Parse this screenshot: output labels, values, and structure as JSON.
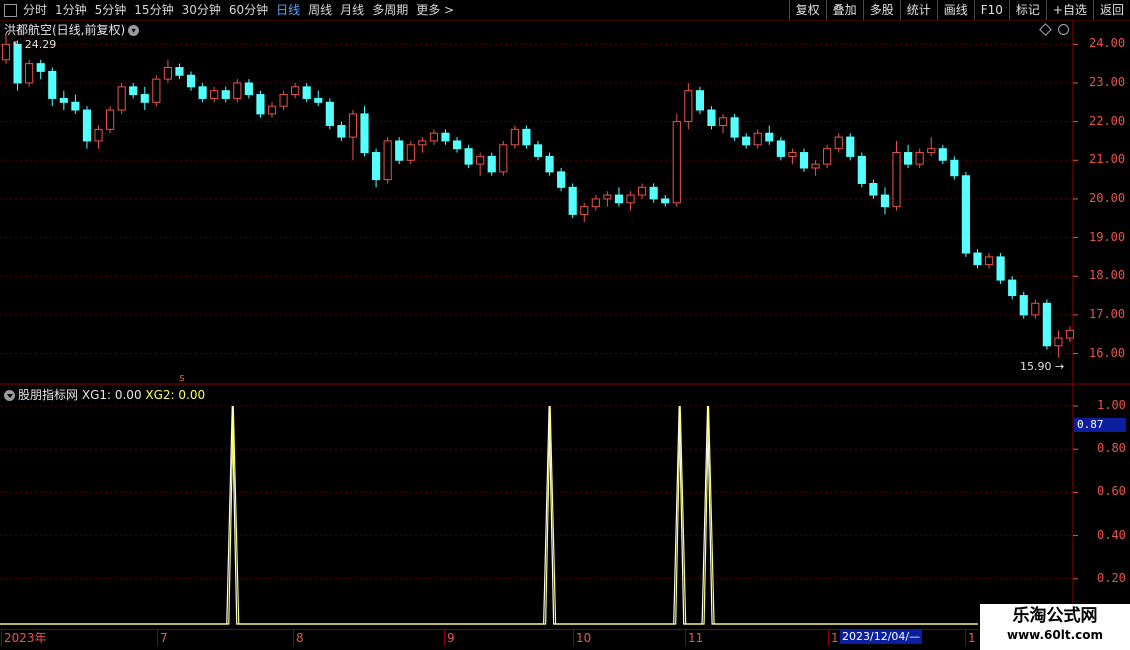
{
  "toolbar": {
    "periods": [
      "分时",
      "1分钟",
      "5分钟",
      "15分钟",
      "30分钟",
      "60分钟",
      "日线",
      "周线",
      "月线",
      "多周期",
      "更多"
    ],
    "active_period": "日线",
    "buttons": [
      "复权",
      "叠加",
      "多股",
      "统计",
      "画线",
      "F10",
      "标记",
      "+自选",
      "返回"
    ]
  },
  "main_chart": {
    "title": "洪都航空(日线,前复权)",
    "max_label": "24.29",
    "min_label": "15.90",
    "y_ticks": [
      "24.00",
      "23.00",
      "22.00",
      "21.00",
      "20.00",
      "19.00",
      "18.00",
      "17.00",
      "16.00"
    ],
    "signal_marker": "s"
  },
  "sub_chart": {
    "indicator_name": "股朋指标网",
    "xg1_label": "XG1: 0.00",
    "xg2_label": "XG2: 0.00",
    "y_ticks": [
      "1.00",
      "0.80",
      "0.60",
      "0.40",
      "0.20"
    ],
    "cursor_value": "0.87"
  },
  "date_axis": {
    "labels": [
      "2023年",
      "7",
      "8",
      "9",
      "10",
      "11",
      "1",
      "1"
    ],
    "current_date": "2023/12/04/—"
  },
  "watermark": {
    "title": "乐淘公式网",
    "url": "www.60lt.com"
  },
  "colors": {
    "up": "#e8544a",
    "down": "#54ffff",
    "xg1": "#ffffff",
    "xg2": "#ffff66",
    "axis": "#8a0000"
  },
  "chart_data": [
    {
      "type": "candlestick",
      "title": "洪都航空(日线,前复权)",
      "ylim": [
        15.6,
        24.5
      ],
      "max": 24.29,
      "min": 15.9,
      "candles": [
        [
          23.6,
          24.29,
          23.5,
          24.0
        ],
        [
          24.0,
          24.1,
          22.8,
          23.0
        ],
        [
          23.0,
          23.6,
          22.9,
          23.5
        ],
        [
          23.5,
          23.6,
          23.1,
          23.3
        ],
        [
          23.3,
          23.4,
          22.4,
          22.6
        ],
        [
          22.6,
          22.8,
          22.3,
          22.5
        ],
        [
          22.5,
          22.7,
          22.2,
          22.3
        ],
        [
          22.3,
          22.4,
          21.3,
          21.5
        ],
        [
          21.5,
          21.9,
          21.3,
          21.8
        ],
        [
          21.8,
          22.4,
          21.7,
          22.3
        ],
        [
          22.3,
          23.0,
          22.2,
          22.9
        ],
        [
          22.9,
          23.0,
          22.6,
          22.7
        ],
        [
          22.7,
          22.9,
          22.3,
          22.5
        ],
        [
          22.5,
          23.2,
          22.4,
          23.1
        ],
        [
          23.1,
          23.6,
          23.0,
          23.4
        ],
        [
          23.4,
          23.5,
          23.1,
          23.2
        ],
        [
          23.2,
          23.3,
          22.8,
          22.9
        ],
        [
          22.9,
          23.0,
          22.5,
          22.6
        ],
        [
          22.6,
          22.9,
          22.5,
          22.8
        ],
        [
          22.8,
          22.9,
          22.5,
          22.6
        ],
        [
          22.6,
          23.1,
          22.5,
          23.0
        ],
        [
          23.0,
          23.1,
          22.6,
          22.7
        ],
        [
          22.7,
          22.8,
          22.1,
          22.2
        ],
        [
          22.2,
          22.5,
          22.1,
          22.4
        ],
        [
          22.4,
          22.8,
          22.3,
          22.7
        ],
        [
          22.7,
          23.0,
          22.6,
          22.9
        ],
        [
          22.9,
          23.0,
          22.5,
          22.6
        ],
        [
          22.6,
          22.8,
          22.4,
          22.5
        ],
        [
          22.5,
          22.6,
          21.8,
          21.9
        ],
        [
          21.9,
          22.0,
          21.5,
          21.6
        ],
        [
          21.6,
          22.3,
          21.0,
          22.2
        ],
        [
          22.2,
          22.4,
          21.1,
          21.2
        ],
        [
          21.2,
          21.3,
          20.3,
          20.5
        ],
        [
          20.5,
          21.6,
          20.4,
          21.5
        ],
        [
          21.5,
          21.6,
          20.9,
          21.0
        ],
        [
          21.0,
          21.5,
          20.9,
          21.4
        ],
        [
          21.4,
          21.6,
          21.2,
          21.5
        ],
        [
          21.5,
          21.8,
          21.4,
          21.7
        ],
        [
          21.7,
          21.8,
          21.4,
          21.5
        ],
        [
          21.5,
          21.6,
          21.2,
          21.3
        ],
        [
          21.3,
          21.4,
          20.8,
          20.9
        ],
        [
          20.9,
          21.2,
          20.6,
          21.1
        ],
        [
          21.1,
          21.2,
          20.6,
          20.7
        ],
        [
          20.7,
          21.5,
          20.6,
          21.4
        ],
        [
          21.4,
          21.9,
          21.3,
          21.8
        ],
        [
          21.8,
          21.9,
          21.3,
          21.4
        ],
        [
          21.4,
          21.5,
          21.0,
          21.1
        ],
        [
          21.1,
          21.2,
          20.6,
          20.7
        ],
        [
          20.7,
          20.8,
          20.2,
          20.3
        ],
        [
          20.3,
          20.4,
          19.5,
          19.6
        ],
        [
          19.6,
          19.9,
          19.4,
          19.8
        ],
        [
          19.8,
          20.1,
          19.7,
          20.0
        ],
        [
          20.0,
          20.2,
          19.8,
          20.1
        ],
        [
          20.1,
          20.3,
          19.8,
          19.9
        ],
        [
          19.9,
          20.2,
          19.7,
          20.1
        ],
        [
          20.1,
          20.4,
          20.0,
          20.3
        ],
        [
          20.3,
          20.4,
          19.9,
          20.0
        ],
        [
          20.0,
          20.1,
          19.8,
          19.9
        ],
        [
          19.9,
          22.2,
          19.8,
          22.0
        ],
        [
          22.0,
          23.0,
          21.8,
          22.8
        ],
        [
          22.8,
          22.9,
          22.2,
          22.3
        ],
        [
          22.3,
          22.4,
          21.8,
          21.9
        ],
        [
          21.9,
          22.2,
          21.7,
          22.1
        ],
        [
          22.1,
          22.2,
          21.5,
          21.6
        ],
        [
          21.6,
          21.7,
          21.3,
          21.4
        ],
        [
          21.4,
          21.8,
          21.3,
          21.7
        ],
        [
          21.7,
          21.9,
          21.4,
          21.5
        ],
        [
          21.5,
          21.6,
          21.0,
          21.1
        ],
        [
          21.1,
          21.3,
          20.9,
          21.2
        ],
        [
          21.2,
          21.3,
          20.7,
          20.8
        ],
        [
          20.8,
          21.0,
          20.6,
          20.9
        ],
        [
          20.9,
          21.4,
          20.8,
          21.3
        ],
        [
          21.3,
          21.7,
          21.2,
          21.6
        ],
        [
          21.6,
          21.7,
          21.0,
          21.1
        ],
        [
          21.1,
          21.2,
          20.3,
          20.4
        ],
        [
          20.4,
          20.5,
          20.0,
          20.1
        ],
        [
          20.1,
          20.3,
          19.6,
          19.8
        ],
        [
          19.8,
          21.5,
          19.7,
          21.2
        ],
        [
          21.2,
          21.4,
          20.8,
          20.9
        ],
        [
          20.9,
          21.3,
          20.8,
          21.2
        ],
        [
          21.2,
          21.6,
          21.1,
          21.3
        ],
        [
          21.3,
          21.4,
          20.9,
          21.0
        ],
        [
          21.0,
          21.1,
          20.5,
          20.6
        ],
        [
          20.6,
          20.7,
          18.5,
          18.6
        ],
        [
          18.6,
          18.7,
          18.2,
          18.3
        ],
        [
          18.3,
          18.6,
          18.2,
          18.5
        ],
        [
          18.5,
          18.6,
          17.8,
          17.9
        ],
        [
          17.9,
          18.0,
          17.4,
          17.5
        ],
        [
          17.5,
          17.6,
          16.9,
          17.0
        ],
        [
          17.0,
          17.4,
          16.9,
          17.3
        ],
        [
          17.3,
          17.4,
          16.1,
          16.2
        ],
        [
          16.2,
          16.6,
          15.9,
          16.4
        ],
        [
          16.4,
          16.7,
          16.3,
          16.6
        ]
      ]
    },
    {
      "type": "line",
      "ylim": [
        0,
        1.0
      ],
      "series": [
        {
          "name": "XG1",
          "spikes": [
            0.238,
            0.562,
            0.695,
            0.724
          ]
        },
        {
          "name": "XG2",
          "spikes": [
            0.238,
            0.562,
            0.695,
            0.724
          ]
        }
      ]
    }
  ]
}
